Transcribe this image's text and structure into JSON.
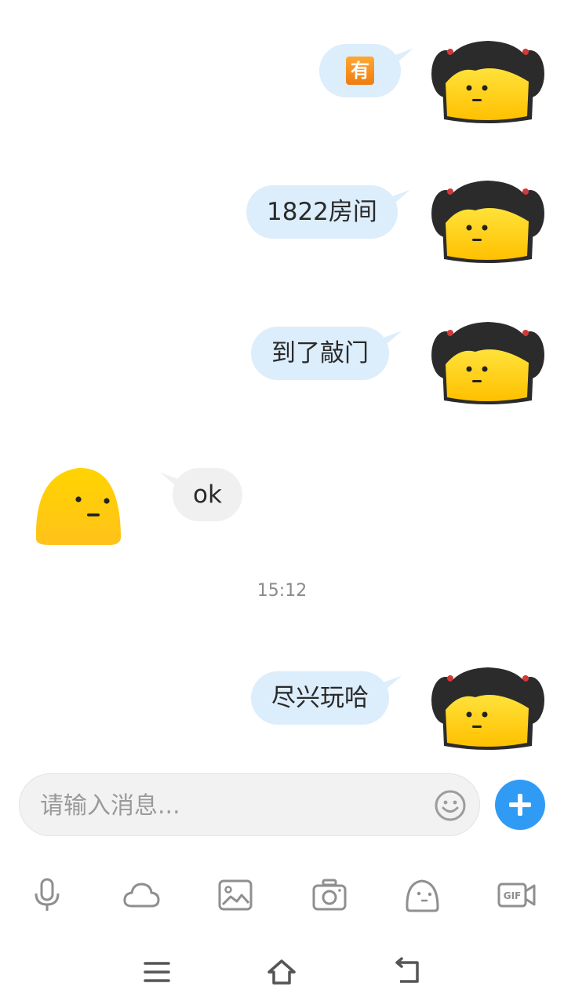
{
  "messages": [
    {
      "side": "out",
      "text": "",
      "emoji": "有"
    },
    {
      "side": "out",
      "text": "1822房间"
    },
    {
      "side": "out",
      "text": "到了敲门"
    },
    {
      "side": "in",
      "text": "ok"
    },
    {
      "side": "out",
      "text": "尽兴玩哈"
    }
  ],
  "timestamp": "15:12",
  "input": {
    "placeholder": "请输入消息..."
  },
  "toolbar": {
    "icons": [
      "microphone-icon",
      "cloud-icon",
      "image-icon",
      "camera-icon",
      "sticker-icon",
      "gif-icon"
    ],
    "gif_label": "GIF"
  },
  "nav": {
    "icons": [
      "menu-icon",
      "home-icon",
      "back-icon"
    ]
  },
  "colors": {
    "outgoing_bubble": "#dcedfb",
    "incoming_bubble": "#f0f0f0",
    "accent": "#2f9bf5",
    "avatar_yellow": "#ffd21a"
  }
}
